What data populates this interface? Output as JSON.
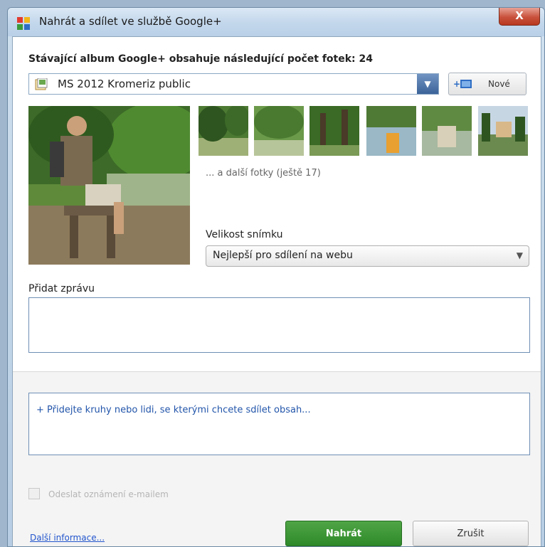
{
  "window": {
    "title": "Nahrát a sdílet ve službě Google+",
    "close_label": "X"
  },
  "album": {
    "info": "Stávající album Google+ obsahuje následující počet fotek: 24",
    "selected": "MS 2012 Kromeriz public",
    "new_button": "Nové"
  },
  "photos": {
    "more_text": "... a další fotky (ještě 17)",
    "thumbnail_count": 6
  },
  "size": {
    "label": "Velikost snímku",
    "selected": "Nejlepší pro sdílení na webu"
  },
  "message": {
    "label": "Přidat zprávu",
    "value": ""
  },
  "share": {
    "placeholder": "+ Přidejte kruhy nebo lidi, se kterými chcete sdílet obsah..."
  },
  "notify": {
    "label": "Odeslat oznámení e-mailem",
    "checked": false,
    "disabled": true
  },
  "footer": {
    "more_info": "Další informace...",
    "upload": "Nahrát",
    "cancel": "Zrušit"
  },
  "colors": {
    "accent_blue": "#3c6399",
    "upload_green": "#2f8a2a",
    "link_blue": "#2255cc"
  }
}
